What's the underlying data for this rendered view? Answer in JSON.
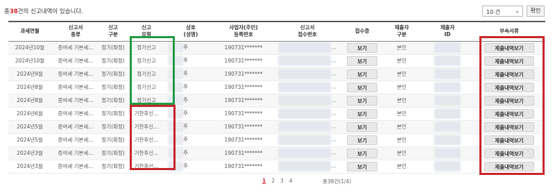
{
  "header": {
    "total_prefix": "총",
    "total_count": "38",
    "total_suffix": "건의 신고내역이 있습니다.",
    "page_size": "10 건",
    "confirm_label": "확인"
  },
  "columns": [
    "과세연월",
    "신고서\n종류",
    "신고\n구분",
    "신고\n유형",
    "상호\n(성명)",
    "사업자(주민)\n등록번호",
    "신고서\n접수번호",
    "접수증",
    "제출자\n구분",
    "제출자\nID",
    "부속서류"
  ],
  "rows": [
    {
      "period": "2024년10월",
      "form": "증여세 기본세...",
      "category": "정기(확정)",
      "type": "정기신고",
      "name": "주",
      "reg_no": "190731*******",
      "receipt_no": "...",
      "receipt": "보기",
      "submitter": "본인",
      "attachment": "제출내역보기"
    },
    {
      "period": "2024년10월",
      "form": "증여세 기본세...",
      "category": "정기(확정)",
      "type": "정기신고",
      "name": "주",
      "reg_no": "190731*******",
      "receipt_no": "...",
      "receipt": "보기",
      "submitter": "본인",
      "attachment": "제출내역보기"
    },
    {
      "period": "2024년9월",
      "form": "증여세 기본세...",
      "category": "정기(확정)",
      "type": "정기신고",
      "name": "주",
      "reg_no": "190731*******",
      "receipt_no": "...",
      "receipt": "보기",
      "submitter": "본인",
      "attachment": "제출내역보기"
    },
    {
      "period": "2024년8월",
      "form": "증여세 기본세...",
      "category": "정기(확정)",
      "type": "정기신고",
      "name": "주",
      "reg_no": "190731*******",
      "receipt_no": "...",
      "receipt": "보기",
      "submitter": "본인",
      "attachment": "제출내역보기"
    },
    {
      "period": "2024년8월",
      "form": "증여세 기본세...",
      "category": "정기(확정)",
      "type": "정기신고",
      "name": "주",
      "reg_no": "190731*******",
      "receipt_no": "...",
      "receipt": "보기",
      "submitter": "본인",
      "attachment": "제출내역보기"
    },
    {
      "period": "2024년6월",
      "form": "증여세 기본세...",
      "category": "정기(확정)",
      "type": "기한후신...",
      "name": "주",
      "reg_no": "190731*******",
      "receipt_no": "...",
      "receipt": "보기",
      "submitter": "본인",
      "attachment": "제출내역보기"
    },
    {
      "period": "2024년5월",
      "form": "증여세 기본세...",
      "category": "정기(확정)",
      "type": "기한후신...",
      "name": "주",
      "reg_no": "190731*******",
      "receipt_no": "...",
      "receipt": "보기",
      "submitter": "본인",
      "attachment": "제출내역보기"
    },
    {
      "period": "2024년5월",
      "form": "증여세 기본세...",
      "category": "정기(확정)",
      "type": "기한후신...",
      "name": "주",
      "reg_no": "190731*******",
      "receipt_no": "...",
      "receipt": "보기",
      "submitter": "본인",
      "attachment": "제출내역보기"
    },
    {
      "period": "2024년3월",
      "form": "증여세 기본세...",
      "category": "정기(확정)",
      "type": "기한후신...",
      "name": "주",
      "reg_no": "190731*******",
      "receipt_no": "...",
      "receipt": "보기",
      "submitter": "본인",
      "attachment": "제출내역보기"
    },
    {
      "period": "2024년3월",
      "form": "증여세 기본세...",
      "category": "정기(확정)",
      "type": "기한후신...",
      "name": "주",
      "reg_no": "190731*******",
      "receipt_no": "...",
      "receipt": "보기",
      "submitter": "본인",
      "attachment": "제출내역보기"
    }
  ],
  "pagination": {
    "pages": [
      "1",
      "2",
      "3",
      "4"
    ],
    "current": "1",
    "info": "총38건(1/4)"
  },
  "colors": {
    "highlight_green": "#1f9a45",
    "highlight_red": "#c9252a",
    "accent": "#d8262b"
  }
}
